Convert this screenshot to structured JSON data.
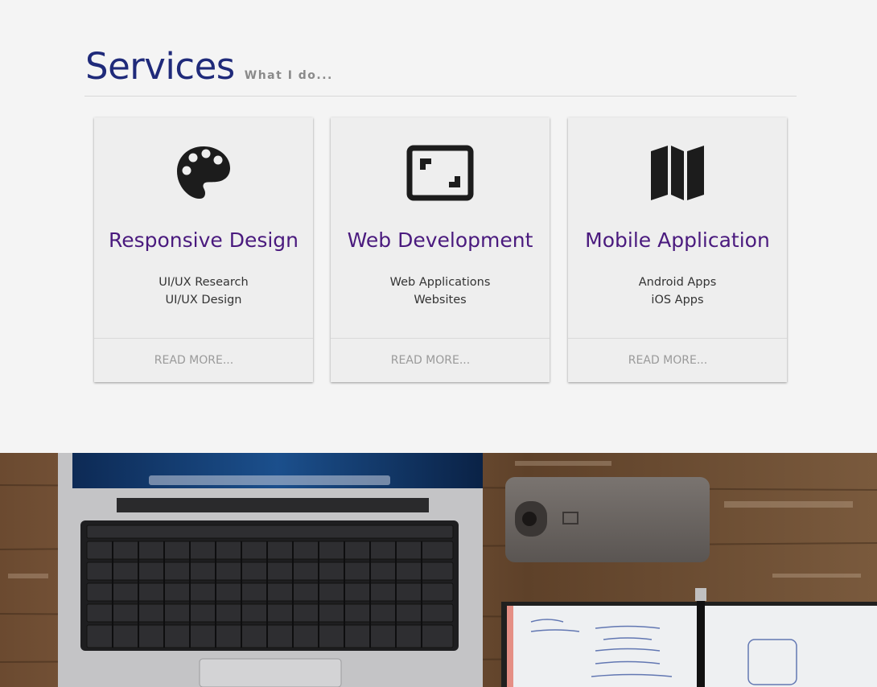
{
  "header": {
    "title": "Services",
    "subtitle": "What I do..."
  },
  "cards": [
    {
      "icon": "palette-icon",
      "title": "Responsive Design",
      "lines": [
        "UI/UX Research",
        "UI/UX Design"
      ],
      "link": "READ MORE..."
    },
    {
      "icon": "aspect-ratio-icon",
      "title": "Web Development",
      "lines": [
        "Web Applications",
        "Websites"
      ],
      "link": "READ MORE..."
    },
    {
      "icon": "map-icon",
      "title": "Mobile Application",
      "lines": [
        "Android Apps",
        "iOS Apps"
      ],
      "link": "READ MORE..."
    }
  ],
  "colors": {
    "heading": "#1f2a7a",
    "card_title": "#4a1a7e",
    "background": "#f4f4f4",
    "card": "#eeeeee"
  }
}
